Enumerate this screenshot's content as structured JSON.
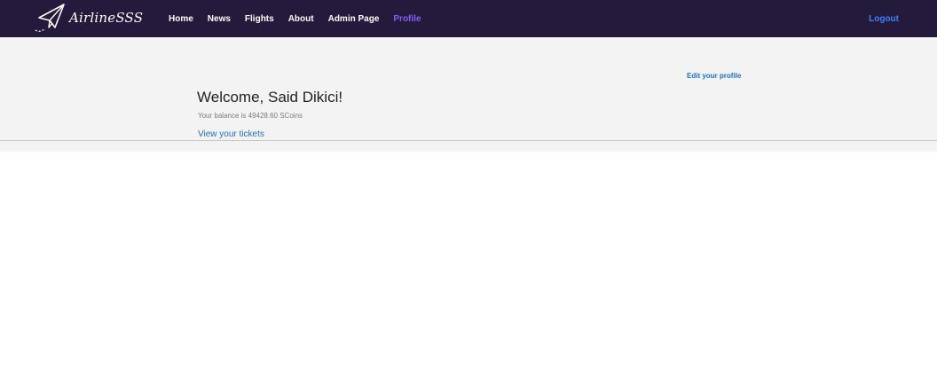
{
  "brand": {
    "name": "AirlineSSS",
    "logo_icon": "paper-plane-icon"
  },
  "nav": {
    "items": [
      {
        "label": "Home"
      },
      {
        "label": "News"
      },
      {
        "label": "Flights"
      },
      {
        "label": "About"
      },
      {
        "label": "Admin Page"
      },
      {
        "label": "Profile",
        "active": true
      }
    ],
    "logout_label": "Logout"
  },
  "profile": {
    "edit_link": "Edit your profile",
    "welcome": "Welcome, Said Dikici!",
    "balance_text": "Your balance is 49428.60 SCoins",
    "tickets_link": "View your tickets"
  },
  "colors": {
    "navbar_bg": "#231a3c",
    "active_nav": "#8a5cf5",
    "link": "#1f6fd6",
    "logout": "#3b82f6",
    "hero_bg": "#f3f3f3"
  }
}
